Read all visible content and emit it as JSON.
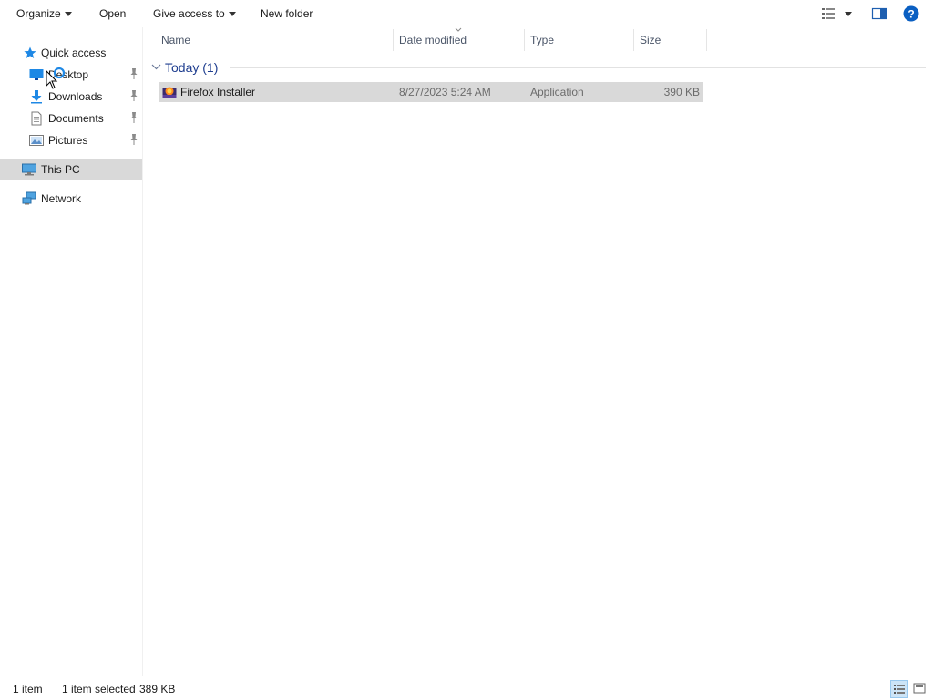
{
  "toolbar": {
    "organize": "Organize",
    "open": "Open",
    "give_access": "Give access to",
    "new_folder": "New folder"
  },
  "sidebar": {
    "quick_access": "Quick access",
    "items": [
      {
        "label": "Desktop",
        "icon": "desktop-icon",
        "pinned": true
      },
      {
        "label": "Downloads",
        "icon": "downloads-icon",
        "pinned": true
      },
      {
        "label": "Documents",
        "icon": "documents-icon",
        "pinned": true
      },
      {
        "label": "Pictures",
        "icon": "pictures-icon",
        "pinned": true
      }
    ],
    "this_pc": "This PC",
    "network": "Network"
  },
  "columns": {
    "name": "Name",
    "date_modified": "Date modified",
    "type": "Type",
    "size": "Size"
  },
  "group": {
    "label": "Today (1)"
  },
  "files": [
    {
      "name": "Firefox Installer",
      "date_modified": "8/27/2023 5:24 AM",
      "type": "Application",
      "size": "390 KB",
      "icon": "firefox-installer-icon",
      "selected": true
    }
  ],
  "status": {
    "item_count": "1 item",
    "selection": "1 item selected",
    "selection_size": "389 KB"
  },
  "colors": {
    "accent": "#1e3d8f",
    "selected_bg": "#d9d9d9",
    "help_blue": "#0a5fc2"
  }
}
